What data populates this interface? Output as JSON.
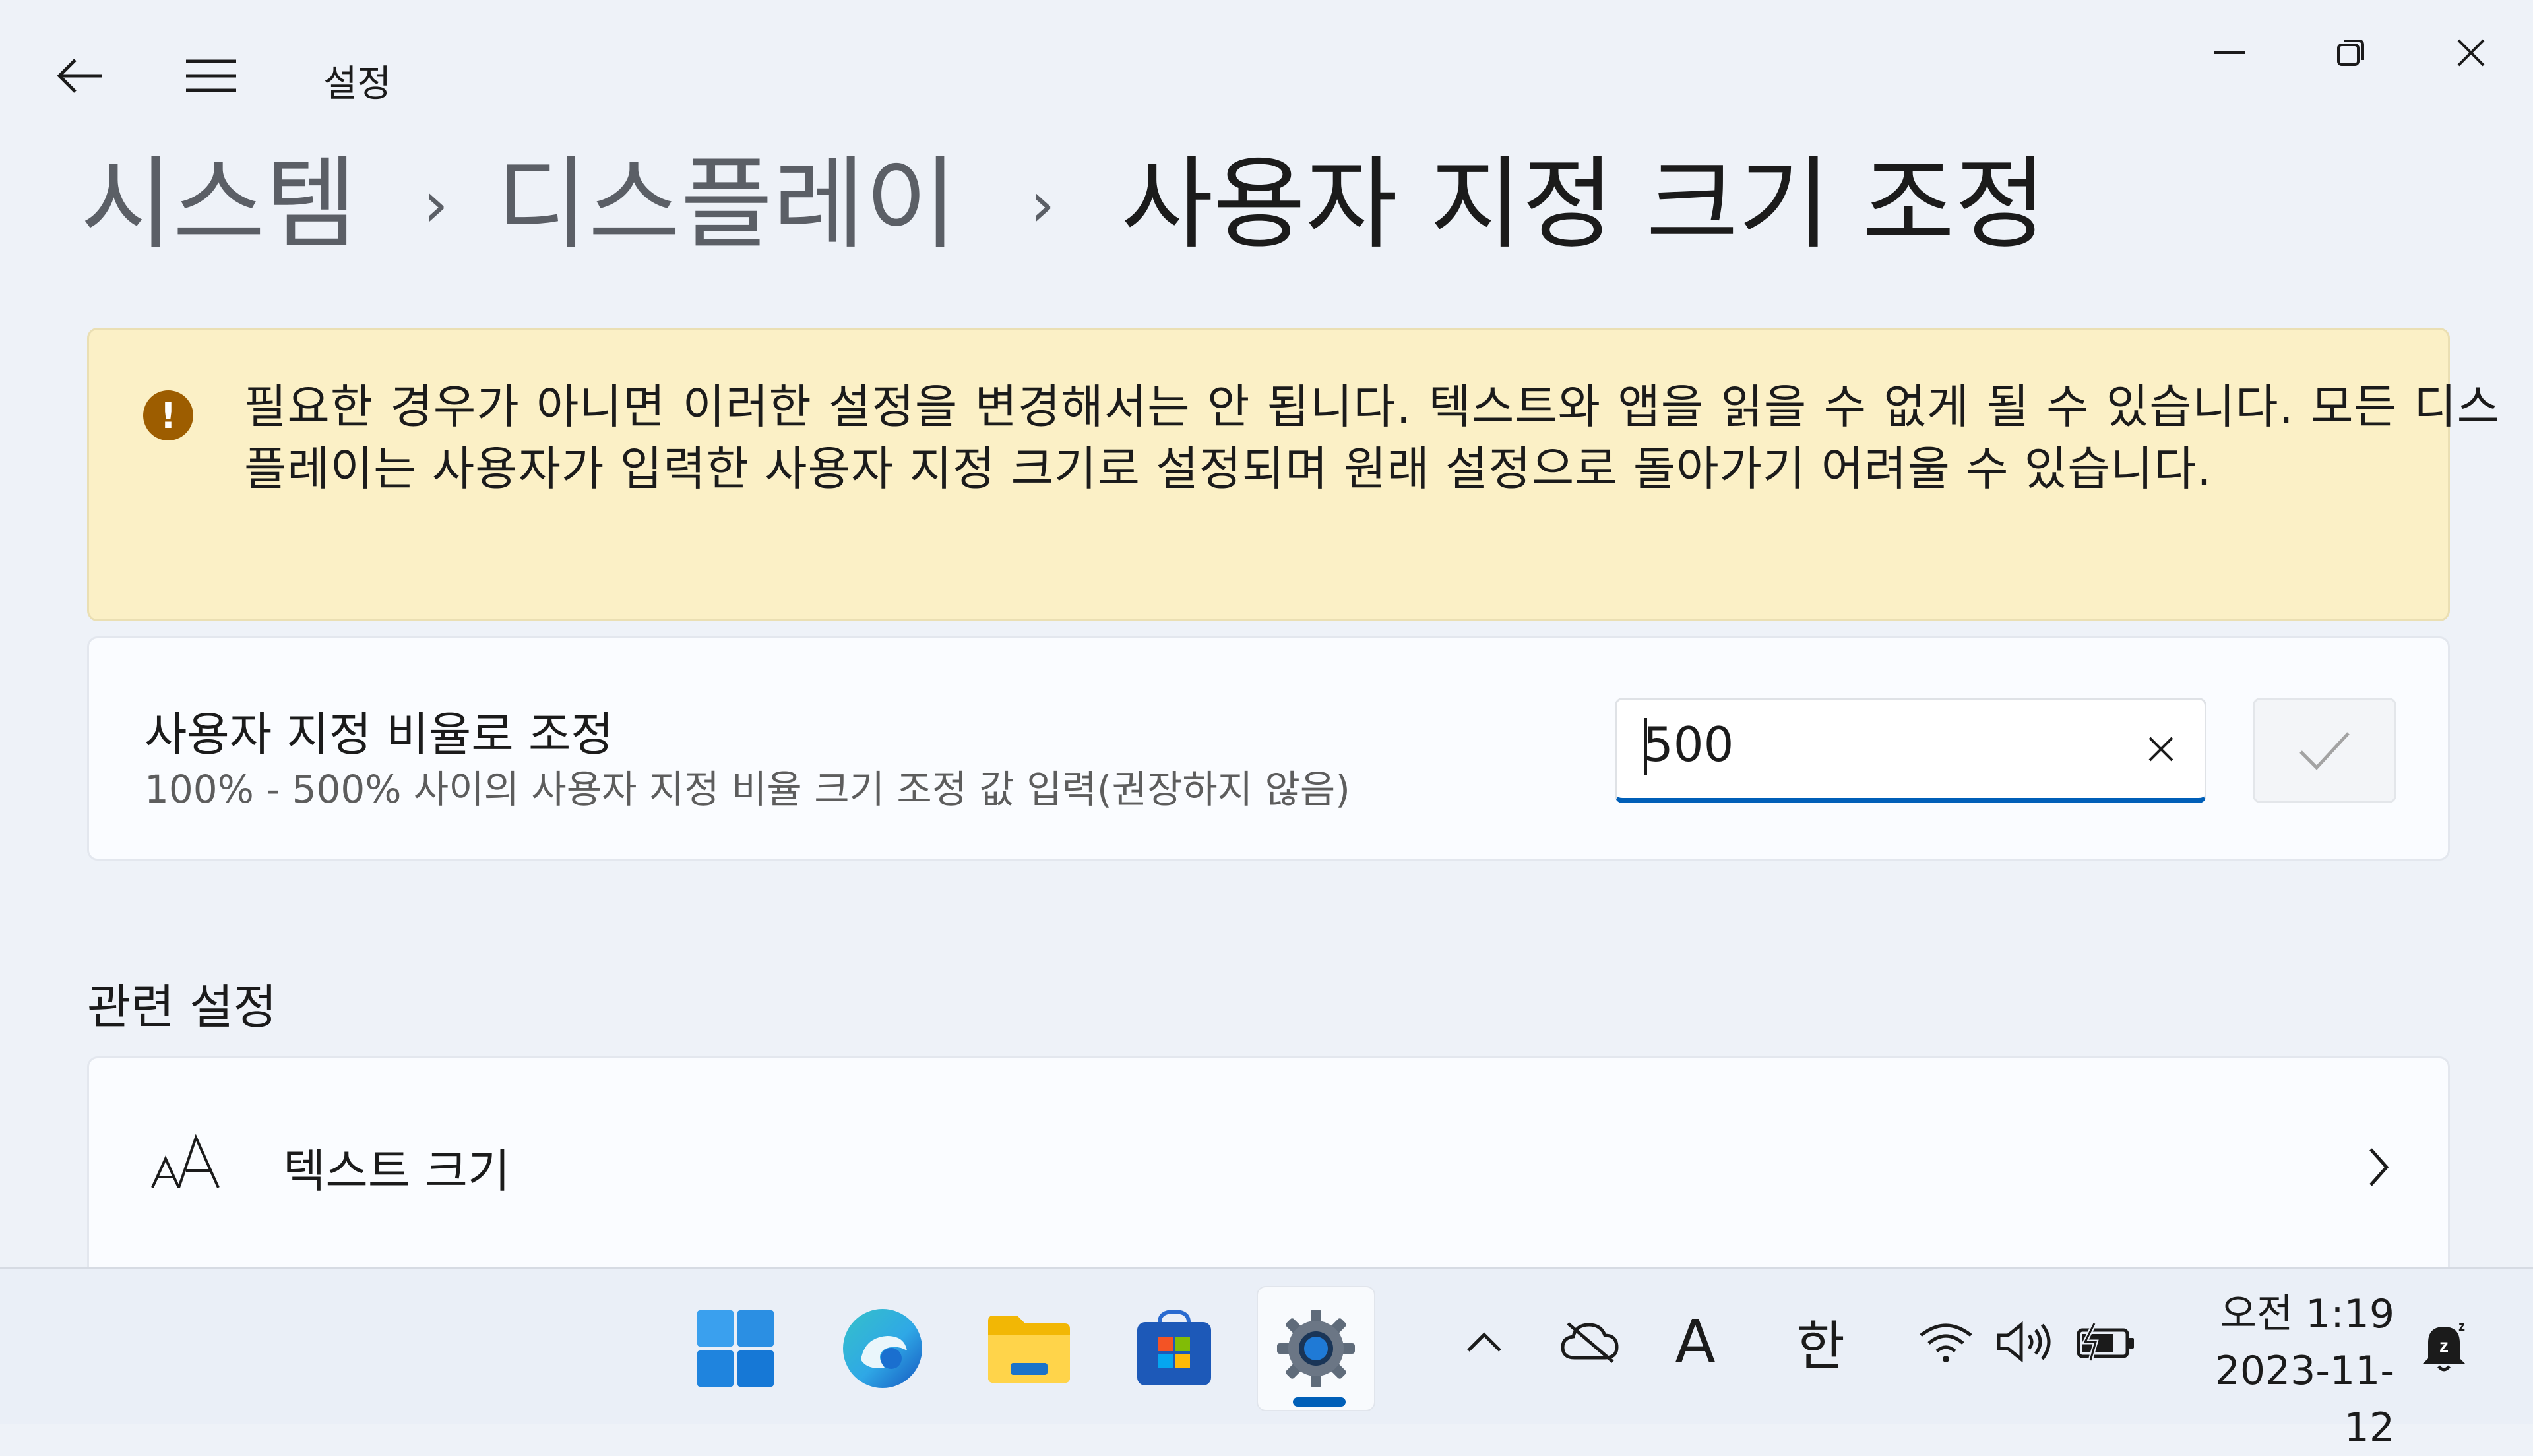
{
  "window": {
    "app_title": "설정",
    "back_icon": "arrow-left-icon",
    "menu_icon": "hamburger-icon"
  },
  "breadcrumb": {
    "items": [
      "시스템",
      "디스플레이",
      "사용자 지정 크기 조정"
    ],
    "separator": "›"
  },
  "warning": {
    "icon": "exclamation-icon",
    "text": "필요한 경우가 아니면 이러한 설정을 변경해서는 안 됩니다. 텍스트와 앱을 읽을 수 없게 될 수 있습니다. 모든 디스플레이는 사용자가 입력한 사용자 지정 크기로 설정되며 원래 설정으로 돌아가기 어려울 수 있습니다."
  },
  "custom_scale": {
    "title": "사용자 지정 비율로 조정",
    "description": "100% - 500% 사이의 사용자 지정 비율 크기 조정 값 입력(권장하지 않음)",
    "input_value": "500"
  },
  "related": {
    "heading": "관련 설정",
    "items": [
      {
        "label": "텍스트 크기",
        "icon": "font-size-icon"
      }
    ]
  },
  "taskbar": {
    "apps": [
      "start",
      "edge",
      "file-explorer",
      "store",
      "settings"
    ],
    "active_app": "settings",
    "tray": {
      "ime_mode_glyph": "A",
      "ime_lang_glyph": "한"
    },
    "clock": {
      "time": "오전 1:19",
      "date": "2023-11-12"
    }
  },
  "colors": {
    "accent": "#005fb8",
    "warning_bg": "#fbf0c6",
    "warning_icon": "#9d5d00"
  }
}
